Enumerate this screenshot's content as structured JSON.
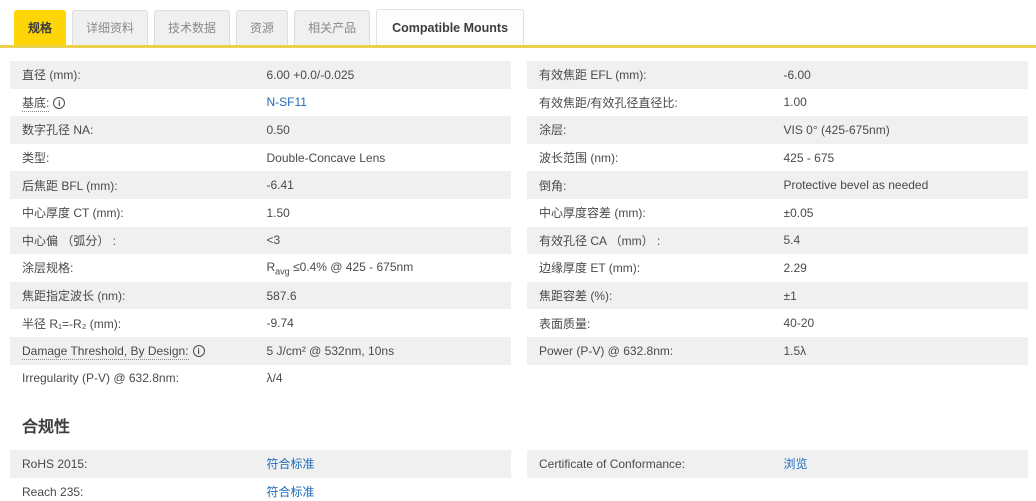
{
  "tabs": {
    "specifications": "规格",
    "details": "详细资料",
    "technical_data": "技术数据",
    "resources": "资源",
    "related_products": "相关产品",
    "compatible_mounts": "Compatible Mounts"
  },
  "specs": {
    "rows": [
      {
        "left": {
          "label": "直径 (mm):",
          "value": "6.00 +0.0/-0.025"
        },
        "right": {
          "label": "有效焦距 EFL (mm):",
          "value": "-6.00"
        }
      },
      {
        "left": {
          "label": "基底:",
          "value": "N-SF11"
        },
        "right": {
          "label": "有效焦距/有效孔径直径比:",
          "value": "1.00"
        }
      },
      {
        "left": {
          "label": "数字孔径 NA:",
          "value": "0.50"
        },
        "right": {
          "label": "涂层:",
          "value": "VIS 0° (425-675nm)"
        }
      },
      {
        "left": {
          "label": "类型:",
          "value": "Double-Concave Lens"
        },
        "right": {
          "label": "波长范围 (nm):",
          "value": "425 - 675"
        }
      },
      {
        "left": {
          "label": "后焦距 BFL (mm):",
          "value": "-6.41"
        },
        "right": {
          "label": "倒角:",
          "value": "Protective bevel as needed"
        }
      },
      {
        "left": {
          "label": "中心厚度 CT (mm):",
          "value": "1.50"
        },
        "right": {
          "label": "中心厚度容差 (mm):",
          "value": "±0.05"
        }
      },
      {
        "left": {
          "label": "中心偏 （弧分） :",
          "value": "<3"
        },
        "right": {
          "label": "有效孔径 CA （mm） :",
          "value": "5.4"
        }
      },
      {
        "left": {
          "label": "涂层规格:",
          "value_parts": [
            "R",
            "avg",
            " ≤0.4% @ 425 - 675nm"
          ]
        },
        "right": {
          "label": "边缘厚度 ET (mm):",
          "value": "2.29"
        }
      },
      {
        "left": {
          "label": "焦距指定波长 (nm):",
          "value": "587.6"
        },
        "right": {
          "label": "焦距容差 (%):",
          "value": "±1"
        }
      },
      {
        "left": {
          "label": "半径 R₁=-R₂ (mm):",
          "value": "-9.74"
        },
        "right": {
          "label": "表面质量:",
          "value": "40-20"
        }
      },
      {
        "left": {
          "label": "Damage Threshold, By Design:",
          "value": "5 J/cm² @ 532nm, 10ns"
        },
        "right": {
          "label": "Power (P-V) @ 632.8nm:",
          "value": "1.5λ"
        }
      },
      {
        "left": {
          "label": "Irregularity (P-V) @ 632.8nm:",
          "value": "λ/4"
        },
        "right": {
          "label": "",
          "value": ""
        }
      }
    ]
  },
  "compliance": {
    "heading": "合规性",
    "rows": [
      {
        "left": {
          "label": "RoHS 2015:",
          "value": "符合标准"
        },
        "right": {
          "label": "Certificate of Conformance:",
          "value": "浏览"
        }
      },
      {
        "left": {
          "label": "Reach 235:",
          "value": "符合标准"
        },
        "right": {
          "label": "",
          "value": ""
        }
      }
    ]
  },
  "colors": {
    "accent_yellow": "#ffd508",
    "tab_underline": "#e9d14b",
    "link_blue": "#1e6cbc",
    "row_alt": "#f0f0f1"
  }
}
